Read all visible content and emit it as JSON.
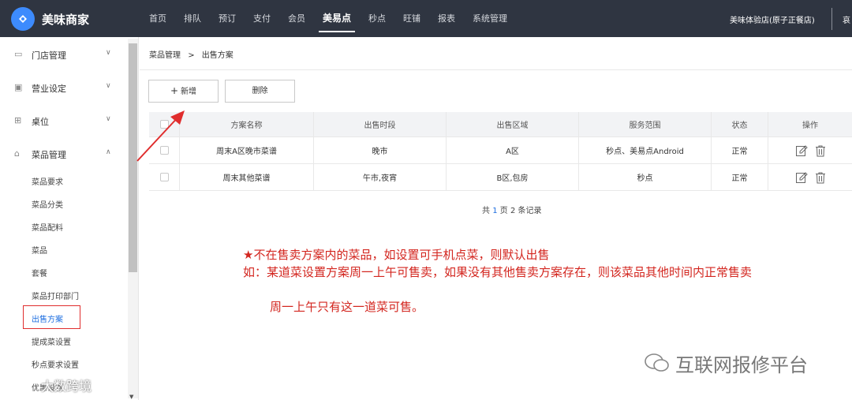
{
  "app": {
    "brand": "美味商家",
    "store": "美味体验店(原子正餐店)",
    "more": "哀"
  },
  "nav": [
    "首页",
    "排队",
    "预订",
    "支付",
    "会员",
    "美易点",
    "秒点",
    "旺铺",
    "报表",
    "系统管理"
  ],
  "nav_active_index": 5,
  "sidebar": {
    "groups": [
      {
        "label": "门店管理",
        "icon": "store-icon",
        "expanded": false
      },
      {
        "label": "营业设定",
        "icon": "settings-icon",
        "expanded": false
      },
      {
        "label": "桌位",
        "icon": "grid-icon",
        "expanded": false
      },
      {
        "label": "菜品管理",
        "icon": "home-icon",
        "expanded": true
      }
    ],
    "sub_items": [
      "菜品要求",
      "菜品分类",
      "菜品配料",
      "菜品",
      "套餐",
      "菜品打印部门",
      "出售方案",
      "提成菜设置",
      "秒点要求设置",
      "优惠设置"
    ],
    "active_sub": "出售方案"
  },
  "breadcrumb": {
    "parent": "菜品管理",
    "sep": ">",
    "current": "出售方案"
  },
  "toolbar": {
    "add_icon": "+",
    "add_label": "新增",
    "delete_label": "删除"
  },
  "table": {
    "headers": [
      "方案名称",
      "出售时段",
      "出售区域",
      "服务范围",
      "状态",
      "操作"
    ],
    "rows": [
      {
        "name": "周末A区晚市菜谱",
        "period": "晚市",
        "area": "A区",
        "scope": "秒点、美易点Android",
        "status": "正常"
      },
      {
        "name": "周末其他菜谱",
        "period": "午市,夜宵",
        "area": "B区,包房",
        "scope": "秒点",
        "status": "正常"
      }
    ]
  },
  "pager": {
    "prefix": "共",
    "pages": "1",
    "mid": "页",
    "records": "2",
    "suffix": "条记录"
  },
  "annotation": {
    "line1": "★不在售卖方案内的菜品，如设置可手机点菜，则默认出售",
    "line2": "如：某道菜设置方案周一上午可售卖，如果没有其他售卖方案存在，则该菜品其他时间内正常售卖",
    "line3": "周一上午只有这一道菜可售。",
    "color": "#d3261f"
  },
  "watermark": {
    "text": "互联网报修平台",
    "text2": "大数跨境"
  }
}
